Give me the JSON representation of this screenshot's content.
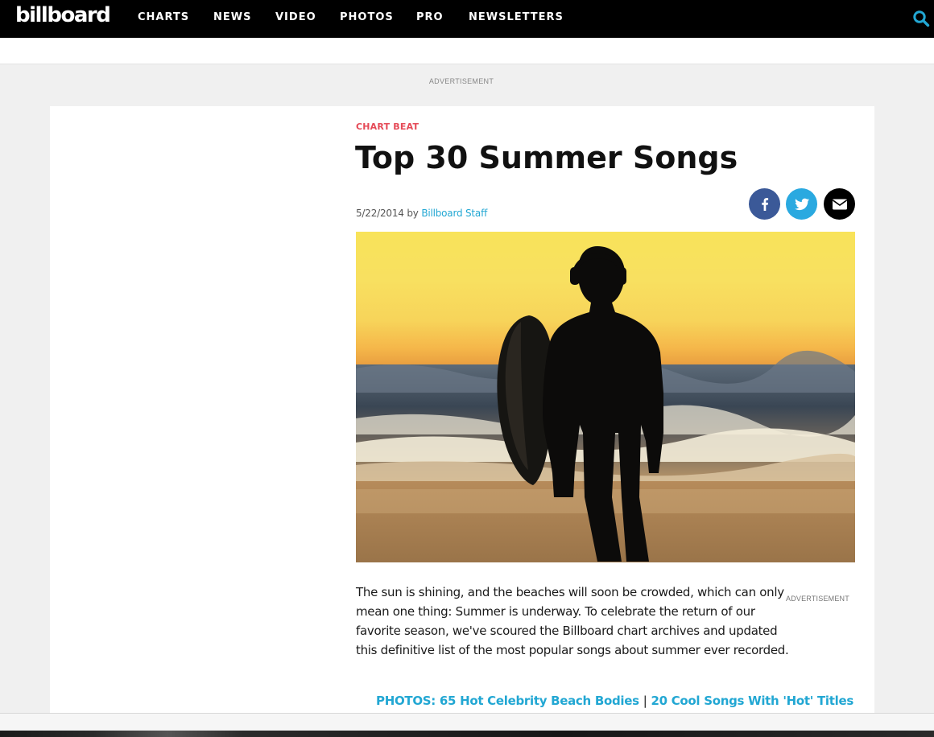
{
  "site": {
    "logo_text": "billboard"
  },
  "nav": {
    "items": [
      {
        "label": "CHARTS"
      },
      {
        "label": "NEWS"
      },
      {
        "label": "VIDEO"
      },
      {
        "label": "PHOTOS"
      },
      {
        "label": "PRO"
      },
      {
        "label": "NEWSLETTERS"
      }
    ],
    "search_icon": "search-icon"
  },
  "ad_top_label": "ADVERTISEMENT",
  "article": {
    "kicker": "CHART BEAT",
    "title": "Top 30 Summer Songs",
    "date": "5/22/2014",
    "by": "by",
    "author": "Billboard Staff",
    "body": "The sun is shining, and the beaches will soon be crowded, which can only mean one thing: Summer is underway. To celebrate the return of our favorite season, we've scoured the Billboard chart archives and updated this definitive list of the most popular songs about summer ever recorded.",
    "side_ad_label": "ADVERTISEMENT",
    "related": [
      {
        "label": "PHOTOS: 65 Hot Celebrity Beach Bodies"
      },
      {
        "label": "20 Cool Songs With 'Hot' Titles"
      }
    ],
    "related_separator": "|"
  },
  "share": [
    {
      "icon": "facebook-icon",
      "color": "#3b5998"
    },
    {
      "icon": "twitter-icon",
      "color": "#2aa9e0"
    },
    {
      "icon": "email-icon",
      "color": "#000000"
    }
  ],
  "colors": {
    "accent_blue": "#22a7d3",
    "kicker_red": "#e54a57",
    "nav_bg": "#000000"
  }
}
